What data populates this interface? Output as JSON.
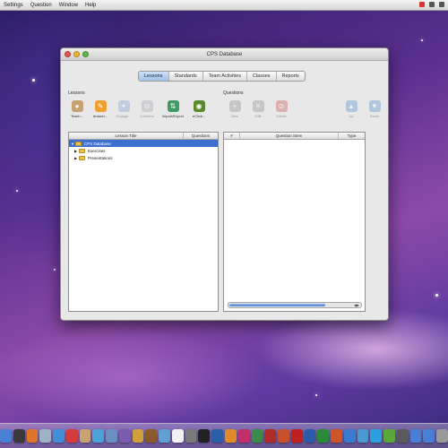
{
  "menubar": {
    "items": [
      "Settings",
      "Question",
      "Window",
      "Help"
    ]
  },
  "window": {
    "title": "CPS Database",
    "tabs": [
      {
        "label": "Lessons",
        "active": true
      },
      {
        "label": "Standards",
        "active": false
      },
      {
        "label": "Team Activities",
        "active": false
      },
      {
        "label": "Classes",
        "active": false
      },
      {
        "label": "Reports",
        "active": false
      }
    ],
    "lessons_section": {
      "label": "Lessons",
      "tools": [
        {
          "label": "Teach...",
          "icon": "teach-icon",
          "enabled": true
        },
        {
          "label": "Answer...",
          "icon": "answer-icon",
          "enabled": true
        },
        {
          "label": "Engage...",
          "icon": "engage-icon",
          "enabled": false
        },
        {
          "label": "Combine",
          "icon": "combine-icon",
          "enabled": false
        },
        {
          "label": "Import/Export",
          "icon": "import-export-icon",
          "enabled": true
        },
        {
          "label": "eClick...",
          "icon": "eclick-icon",
          "enabled": true
        }
      ],
      "columns": [
        "Lesson Title",
        "Questions"
      ],
      "tree": [
        {
          "label": "CPS Database",
          "selected": true,
          "expanded": true
        },
        {
          "label": "Exercises",
          "selected": false,
          "expanded": false
        },
        {
          "label": "Presentations",
          "selected": false,
          "expanded": false
        }
      ]
    },
    "questions_section": {
      "label": "Questions",
      "tools": [
        {
          "label": "New",
          "icon": "new-question-icon",
          "enabled": false
        },
        {
          "label": "Edit",
          "icon": "edit-icon",
          "enabled": false
        },
        {
          "label": "Delete",
          "icon": "delete-icon",
          "enabled": false
        },
        {
          "label": "Up",
          "icon": "up-arrow-icon",
          "enabled": false
        },
        {
          "label": "Down",
          "icon": "down-arrow-icon",
          "enabled": false
        }
      ],
      "columns": [
        "#",
        "Question Stem",
        "Type"
      ],
      "scroll_position": 0.72
    }
  },
  "dock": {
    "icons": [
      "finder-icon",
      "dashboard-icon",
      "firefox-icon",
      "mail-icon",
      "safari-icon",
      "ical-icon",
      "address-book-icon",
      "itunes-icon",
      "iphoto-icon",
      "imovie-icon",
      "garageband-icon",
      "guitar-icon",
      "preview-icon",
      "textedit-icon",
      "system-preferences-icon",
      "terminal-icon",
      "photoshop-icon",
      "illustrator-icon",
      "indesign-icon",
      "dreamweaver-icon",
      "flash-icon",
      "fireworks-icon",
      "acrobat-icon",
      "word-icon",
      "excel-icon",
      "powerpoint-icon",
      "entourage-icon",
      "chrome-icon",
      "skype-icon",
      "cps-icon",
      "activity-monitor-icon",
      "folder-icon",
      "downloads-icon",
      "trash-icon"
    ]
  }
}
